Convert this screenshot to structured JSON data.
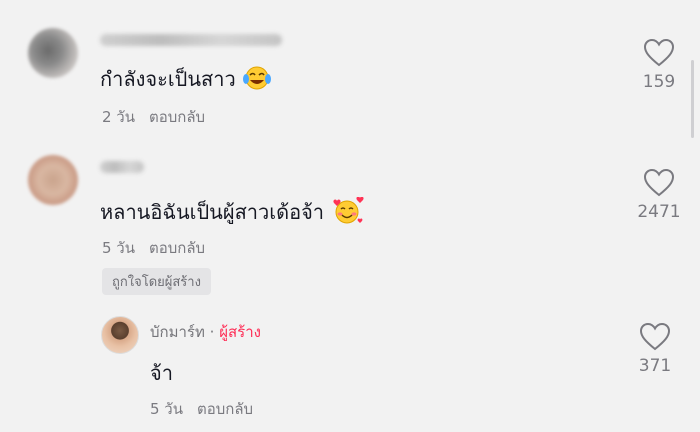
{
  "comments": [
    {
      "text": "กำลังจะเป็นสาว",
      "emoji": "laughing-tears-emoji",
      "time": "2 วัน",
      "reply_label": "ตอบกลับ",
      "likes": "159"
    },
    {
      "text": "หลานอิฉันเป็นผู้สาวเด้อจ้า",
      "emoji": "smiling-hearts-emoji",
      "time": "5 วัน",
      "reply_label": "ตอบกลับ",
      "liked_by_creator": "ถูกใจโดยผู้สร้าง",
      "likes": "2471"
    }
  ],
  "reply": {
    "author": "บักมาร์ท",
    "separator": "·",
    "creator_tag": "ผู้สร้าง",
    "text": "จ้า",
    "time": "5 วัน",
    "reply_label": "ตอบกลับ",
    "likes": "371"
  },
  "colors": {
    "background": "#f2f2f2",
    "text": "#161823",
    "meta": "#7a7a80",
    "creator_accent": "#fe2c55"
  },
  "icons": [
    "heart-outline-icon"
  ]
}
